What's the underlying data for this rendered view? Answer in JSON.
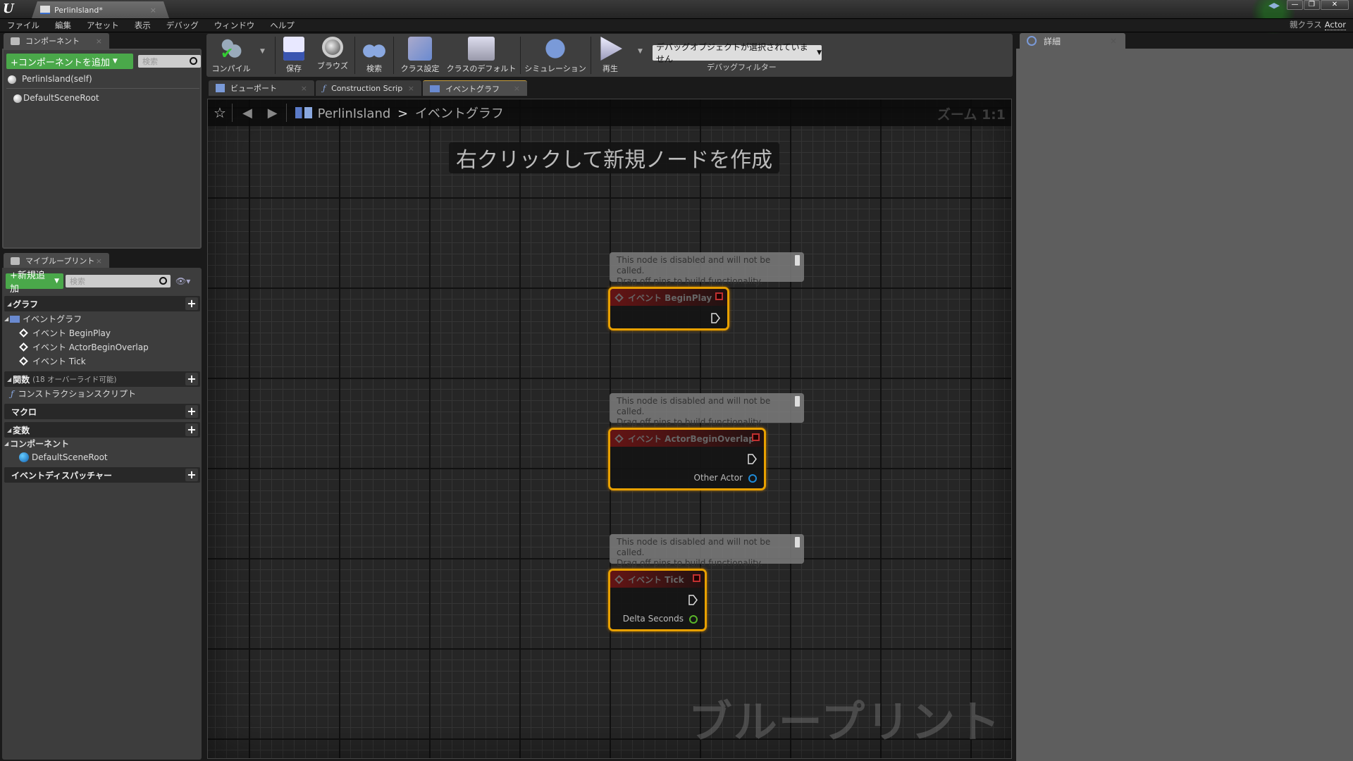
{
  "window": {
    "tab_title": "PerlinIsland*",
    "parent_class_label": "親クラス",
    "parent_class_value": "Actor",
    "controls": {
      "minimize": "—",
      "restore": "❐",
      "close": "✕"
    }
  },
  "menu": [
    "ファイル",
    "編集",
    "アセット",
    "表示",
    "デバッグ",
    "ウィンドウ",
    "ヘルプ"
  ],
  "components_panel": {
    "tab_label": "コンポーネント",
    "add_button": "+コンポーネントを追加",
    "search_placeholder": "検索",
    "items": [
      "PerlinIsland(self)",
      "DefaultSceneRoot"
    ]
  },
  "my_blueprint_panel": {
    "tab_label": "マイブループリント",
    "add_new_button": "+新規追加",
    "search_placeholder": "検索",
    "sections": {
      "graphs": "グラフ",
      "event_graph": "イベントグラフ",
      "events": [
        "イベント BeginPlay",
        "イベント ActorBeginOverlap",
        "イベント Tick"
      ],
      "functions": "関数",
      "functions_note": "(18 オーバーライド可能)",
      "construction_script": "コンストラクションスクリプト",
      "macros": "マクロ",
      "variables": "変数",
      "components": "コンポーネント",
      "component_item": "DefaultSceneRoot",
      "event_dispatchers": "イベントディスパッチャー"
    }
  },
  "toolbar": {
    "compile": "コンパイル",
    "save": "保存",
    "browse": "ブラウズ",
    "search": "検索",
    "class_settings": "クラス設定",
    "class_defaults": "クラスのデフォルト",
    "simulation": "シミュレーション",
    "play": "再生",
    "debug_object": "デバッグオブジェクトが選択されていません",
    "debug_filter": "デバッグフィルター"
  },
  "editor_tabs": [
    {
      "label": "ビューポート",
      "active": false
    },
    {
      "label": "Construction Scrip",
      "active": false
    },
    {
      "label": "イベントグラフ",
      "active": true
    }
  ],
  "graph": {
    "breadcrumb": {
      "blueprint": "PerlinIsland",
      "separator": ">",
      "graph": "イベントグラフ"
    },
    "zoom": "ズーム 1:1",
    "hint": "右クリックして新規ノードを作成",
    "watermark": "ブループリント",
    "disabled_comment_line1": "This node is disabled and will not be called.",
    "disabled_comment_line2": "Drag off pins to build functionality.",
    "nodes": [
      {
        "title": "イベント BeginPlay",
        "pins": []
      },
      {
        "title": "イベント ActorBeginOverlap",
        "pins": [
          "Other Actor"
        ]
      },
      {
        "title": "イベント Tick",
        "pins": [
          "Delta Seconds"
        ]
      }
    ],
    "colors": {
      "node_border": "#e8a000",
      "object_pin": "#1e8ad6",
      "float_pin": "#5ab52a",
      "header_red": "#c03030"
    }
  },
  "details_panel": {
    "tab_label": "詳細"
  }
}
